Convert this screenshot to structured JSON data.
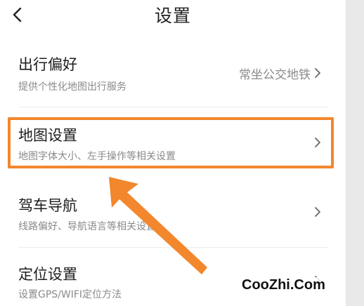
{
  "header": {
    "title": "设置",
    "back_icon": "chevron-left-icon"
  },
  "rows": [
    {
      "title": "出行偏好",
      "subtitle": "提供个性化地图出行服务",
      "value": "常坐公交地铁"
    },
    {
      "title": "地图设置",
      "subtitle": "地图字体大小、左手操作等相关设置",
      "value": ""
    },
    {
      "title": "驾车导航",
      "subtitle": "线路偏好、导航语言等相关设置",
      "value": ""
    },
    {
      "title": "定位设置",
      "subtitle": "设置GPS/WIFI定位方法",
      "value": ""
    }
  ],
  "chevron_icon": "chevron-right-icon",
  "annotation": {
    "highlight_color": "#f2872d",
    "arrow_color": "#f2872d"
  },
  "watermark": "CooZhi.Com"
}
